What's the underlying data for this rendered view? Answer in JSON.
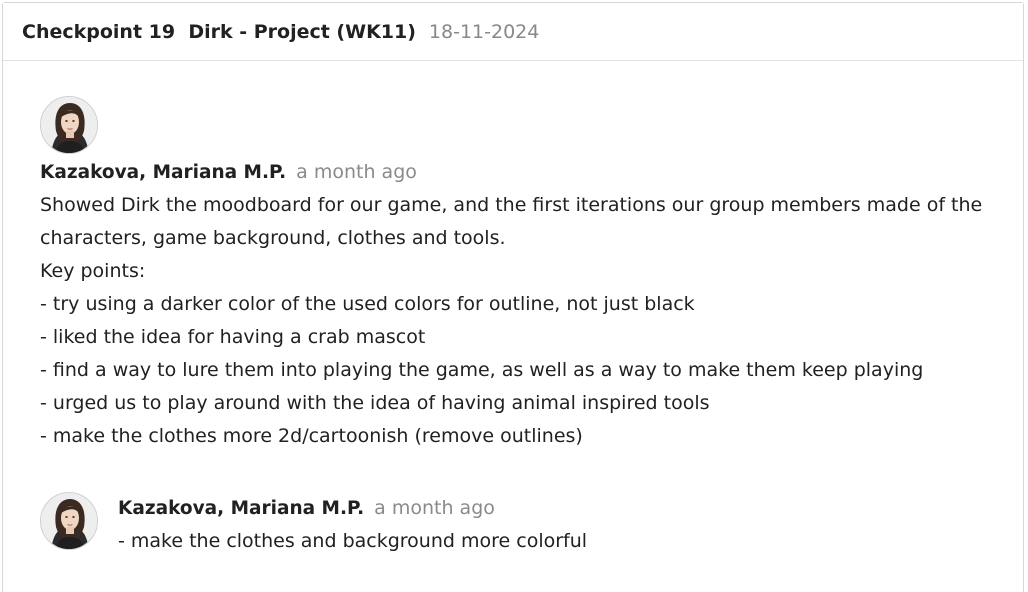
{
  "header": {
    "title": "Checkpoint 19  Dirk - Project (WK11)",
    "date": "18-11-2024"
  },
  "comments": [
    {
      "author": "Kazakova, Mariana M.P.",
      "time": "a month ago",
      "lines": [
        "Showed Dirk the moodboard for our game, and the first iterations our group members made of the",
        "characters, game background, clothes and tools.",
        "Key points:",
        "- try using a darker color of the used colors for outline, not just black",
        "- liked the idea for having a crab mascot",
        "- find a way to lure them into playing the game, as well as a way to make them keep playing",
        "- urged us to play around with the idea of having animal inspired tools",
        "- make the clothes more 2d/cartoonish (remove outlines)"
      ]
    },
    {
      "author": "Kazakova, Mariana M.P.",
      "time": "a month ago",
      "lines": [
        "- make the clothes and background more colorful"
      ]
    }
  ]
}
